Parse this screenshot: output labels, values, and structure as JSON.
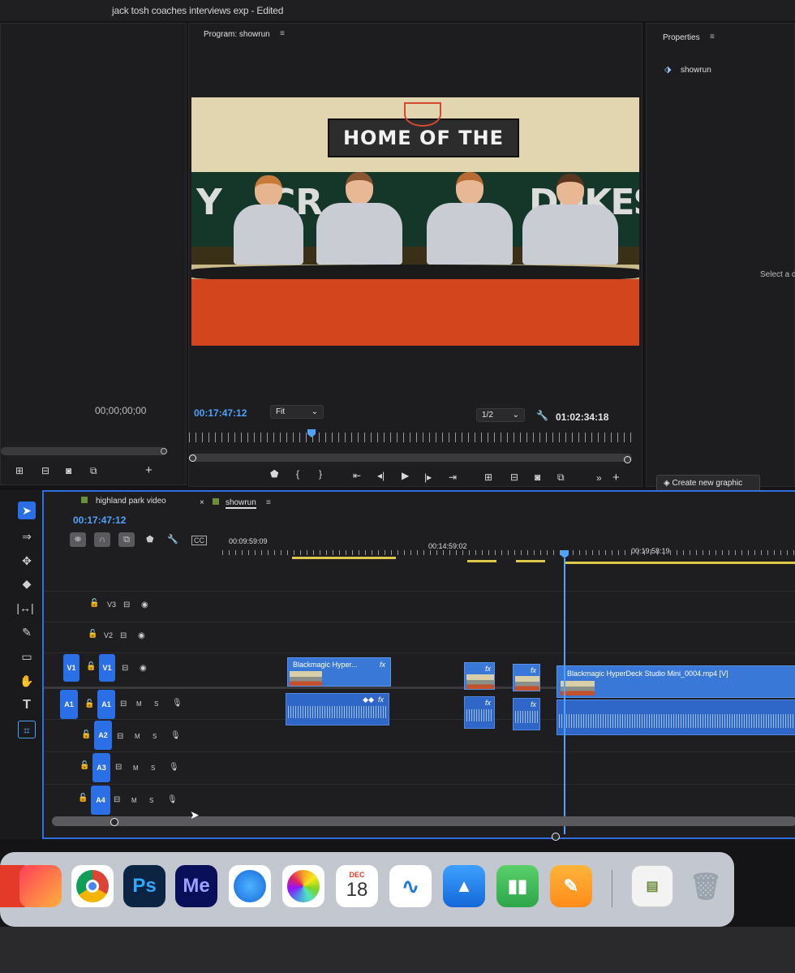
{
  "window": {
    "title": "jack tosh coaches interviews exp - Edited"
  },
  "source_monitor": {
    "timecode": "00;00;00;00"
  },
  "program_monitor": {
    "title": "Program: showrun",
    "current_timecode": "00:17:47:12",
    "zoom_value": "Fit",
    "resolution_value": "1/2",
    "duration_timecode": "01:02:34:18",
    "video": {
      "banner_text": "HOME OF THE",
      "wall_letters_left": "Y",
      "wall_letters_mid": "CR",
      "wall_letters_right": "DUKES"
    }
  },
  "properties_panel": {
    "title": "Properties",
    "sequence_name": "showrun",
    "hint_text": "Select a c",
    "create_graphic_label": "Create new graphic"
  },
  "timeline": {
    "tabs": [
      {
        "label": "highland park video"
      },
      {
        "label": "showrun"
      }
    ],
    "current_timecode": "00:17:47:12",
    "ruler_labels": [
      "00:09:59:09",
      "00:14:59:02",
      "00:19:58:19"
    ],
    "tracks": {
      "video": [
        "V3",
        "V2",
        "V1"
      ],
      "audio": [
        "A1",
        "A2",
        "A3",
        "A4"
      ],
      "source_v": "V1",
      "source_a": "A1"
    },
    "clip_labels": {
      "clip1": "Blackmagic Hyper...",
      "clip4": "Blackmagic HyperDeck Studio Mini_0004.mp4 [V]",
      "fx": "fx"
    },
    "audio_buttons": {
      "mute": "M",
      "solo": "S"
    }
  },
  "dock": {
    "apps": [
      {
        "name": "Creative Cloud",
        "label": ""
      },
      {
        "name": "Chrome",
        "label": ""
      },
      {
        "name": "Photoshop",
        "label": "Ps"
      },
      {
        "name": "Media Encoder",
        "label": "Me"
      },
      {
        "name": "Safari",
        "label": ""
      },
      {
        "name": "Photos",
        "label": ""
      },
      {
        "name": "Calendar",
        "label": "18",
        "month": "DEC"
      },
      {
        "name": "Freeform",
        "label": ""
      },
      {
        "name": "Keynote",
        "label": ""
      },
      {
        "name": "Numbers",
        "label": ""
      },
      {
        "name": "Pages",
        "label": ""
      },
      {
        "name": "Preview",
        "label": ""
      },
      {
        "name": "Trash",
        "label": ""
      }
    ]
  },
  "colors": {
    "accent_blue": "#2b6fe6",
    "timecode_blue": "#4ea3ff",
    "panel_bg": "#1d1d1f",
    "clip_blue": "#3a78d8",
    "work_area_yellow": "#e0c84a"
  }
}
